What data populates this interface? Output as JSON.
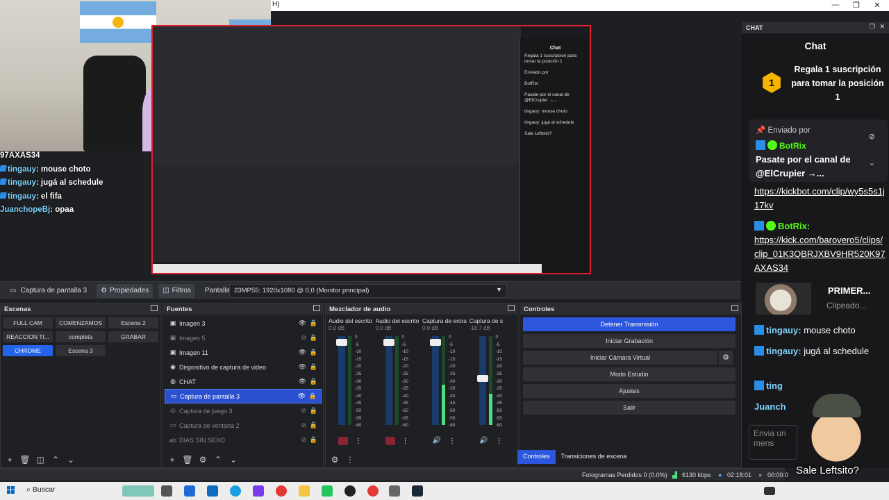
{
  "window": {
    "menu_help": "H)",
    "minimize": "—",
    "restore": "❐",
    "close": "✕"
  },
  "webcam_chat": [
    {
      "user": "",
      "text": "97AXAS34",
      "badge": false
    },
    {
      "user": "tingauy",
      "text": ": mouse choto",
      "badge": true
    },
    {
      "user": "tingauy",
      "text": ": jugá al schedule",
      "badge": true
    },
    {
      "user": "tingauy",
      "text": ": el fifa",
      "badge": true
    },
    {
      "user": "JuanchopeBj",
      "text": ": opaa",
      "badge": false
    }
  ],
  "preview": {
    "chat_title": "Chat",
    "mini_rank": "Regala 1 suscripción para tomar la posición 1",
    "mini_msgs": [
      "Enviado por",
      "BotRix:",
      "Pasate por el canal de @ElCrupier →...",
      "tingauy: mouse choto",
      "tingauy: jugá al schedule",
      "Sale Leftsito?"
    ]
  },
  "source_toolbar": {
    "source_name": "Captura de pantalla 3",
    "properties": "Propiedades",
    "filters": "Filtros",
    "display_label": "Pantalla",
    "display_value": "23MP55: 1920x1080 @ 0,0 (Monitor principal)"
  },
  "scenes": {
    "title": "Escenas",
    "items": [
      {
        "label": "FULL CAM",
        "active": false
      },
      {
        "label": "COMENZAMOS",
        "active": false
      },
      {
        "label": "Escena 2",
        "active": false
      },
      {
        "label": "REACCION TI...",
        "active": false
      },
      {
        "label": "completa",
        "active": false
      },
      {
        "label": "GRABAR",
        "active": false
      },
      {
        "label": "CHROME",
        "active": true
      },
      {
        "label": "Escena 3",
        "active": false
      }
    ]
  },
  "sources": {
    "title": "Fuentes",
    "items": [
      {
        "label": "Imagen 3",
        "icon": "▣",
        "dim": false,
        "sel": false,
        "eye": "👁"
      },
      {
        "label": "Imagen 5",
        "icon": "▣",
        "dim": true,
        "sel": false,
        "eye": "⊘"
      },
      {
        "label": "Imagen 11",
        "icon": "▣",
        "dim": false,
        "sel": false,
        "eye": "👁"
      },
      {
        "label": "Dispositivo de captura de video",
        "icon": "◉",
        "dim": false,
        "sel": false,
        "eye": "👁"
      },
      {
        "label": "CHAT",
        "icon": "◍",
        "dim": false,
        "sel": false,
        "eye": "👁"
      },
      {
        "label": "Captura de pantalla 3",
        "icon": "▭",
        "dim": false,
        "sel": true,
        "eye": "👁"
      },
      {
        "label": "Captura de juego 3",
        "icon": "◎",
        "dim": true,
        "sel": false,
        "eye": "⊘"
      },
      {
        "label": "Captura de ventana 2",
        "icon": "▭",
        "dim": true,
        "sel": false,
        "eye": "⊘"
      },
      {
        "label": "DIAS SIN SEXO",
        "icon": "ab",
        "dim": true,
        "sel": false,
        "eye": "⊘"
      }
    ]
  },
  "mixer": {
    "title": "Mezclador de audio",
    "channels": [
      {
        "name": "Audio del escrito",
        "db": "0.0 dB",
        "level": 0.0,
        "knob": 0.93,
        "muted": true
      },
      {
        "name": "Audio del escrito",
        "db": "0.0 dB",
        "level": 0.0,
        "knob": 0.93,
        "muted": true
      },
      {
        "name": "Captura de entra",
        "db": "0.0 dB",
        "level": 0.45,
        "knob": 0.93,
        "muted": false
      },
      {
        "name": "Captura de s",
        "db": "-18.7 dB",
        "level": 0.35,
        "knob": 0.52,
        "muted": false
      }
    ],
    "scale": [
      "0",
      "-5",
      "-10",
      "-15",
      "-20",
      "-25",
      "-30",
      "-35",
      "-40",
      "-45",
      "-50",
      "-55",
      "-60"
    ]
  },
  "controls": {
    "title": "Controles",
    "buttons": [
      "Detener Transmisión",
      "Iniciar Grabación",
      "Iniciar Cámara Virtual",
      "Modo Estudio",
      "Ajustes",
      "Salir"
    ],
    "tab_controls": "Controles",
    "tab_transitions": "Transiciones de escena"
  },
  "status": {
    "dropped": "Fotogramas Perdidos 0 (0.0%)",
    "bitrate": "6130 kbps",
    "live_time": "02:18:01",
    "rec_time": "00:00:0"
  },
  "chat_dock": {
    "header": "CHAT",
    "title": "Chat",
    "rank_number": "1",
    "rank_text": "Regala 1 suscripción para tomar la posición 1",
    "pinned_label": "Enviado por",
    "pinned_user": "BotRix",
    "pinned_msg": "Pasate por el canal de @ElCrupier →...",
    "link1": "https://kickbot.com/clip/wy5s5s1j17kv",
    "bot_user": "BotRix:",
    "link2": "https://kick.com/barovero5/clips/clip_01K3QBRJXBV9HR520K97AXAS34",
    "clip_title": "PRIMER...",
    "clip_sub": "Clipeado...",
    "msg1_user": "tingauy:",
    "msg1_text": "mouse choto",
    "msg2_user": "tingauy:",
    "msg2_text": "jugá al schedule",
    "msg3_user": "ting",
    "msg4_user": "Juanch",
    "send_placeholder": "Envia un mens",
    "overlay_text": "Sale Leftsito?"
  },
  "taskbar": {
    "search": "Buscar"
  },
  "colors": {
    "accent": "#2c56dd",
    "kick_green": "#53fc18",
    "preview_border": "#e0202a"
  }
}
